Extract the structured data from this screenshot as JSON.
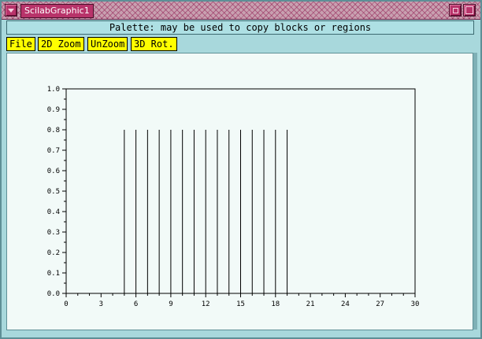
{
  "window": {
    "title": "ScilabGraphic1",
    "message": "Palette: may be used to copy  blocks or regions"
  },
  "menu": {
    "items": [
      "File",
      "2D Zoom",
      "UnZoom",
      "3D Rot."
    ]
  },
  "colors": {
    "title_accent": "#b8336a",
    "menu_button": "#ffff00",
    "window_bg": "#a8d8dc",
    "plot_bg": "#f2faf8"
  },
  "chart_data": {
    "type": "bar",
    "x": [
      5,
      6,
      7,
      8,
      9,
      10,
      11,
      12,
      13,
      14,
      15,
      16,
      17,
      18,
      19
    ],
    "values": [
      0.8,
      0.8,
      0.8,
      0.8,
      0.8,
      0.8,
      0.8,
      0.8,
      0.8,
      0.8,
      0.8,
      0.8,
      0.8,
      0.8,
      0.8
    ],
    "xlim": [
      0,
      30
    ],
    "ylim": [
      0,
      1.0
    ],
    "xticks": [
      "0",
      "3",
      "6",
      "9",
      "12",
      "15",
      "18",
      "21",
      "24",
      "27",
      "30"
    ],
    "yticks": [
      "0.0",
      "0.1",
      "0.2",
      "0.3",
      "0.4",
      "0.5",
      "0.6",
      "0.7",
      "0.8",
      "0.9",
      "1.0"
    ],
    "title": "",
    "xlabel": "",
    "ylabel": ""
  }
}
